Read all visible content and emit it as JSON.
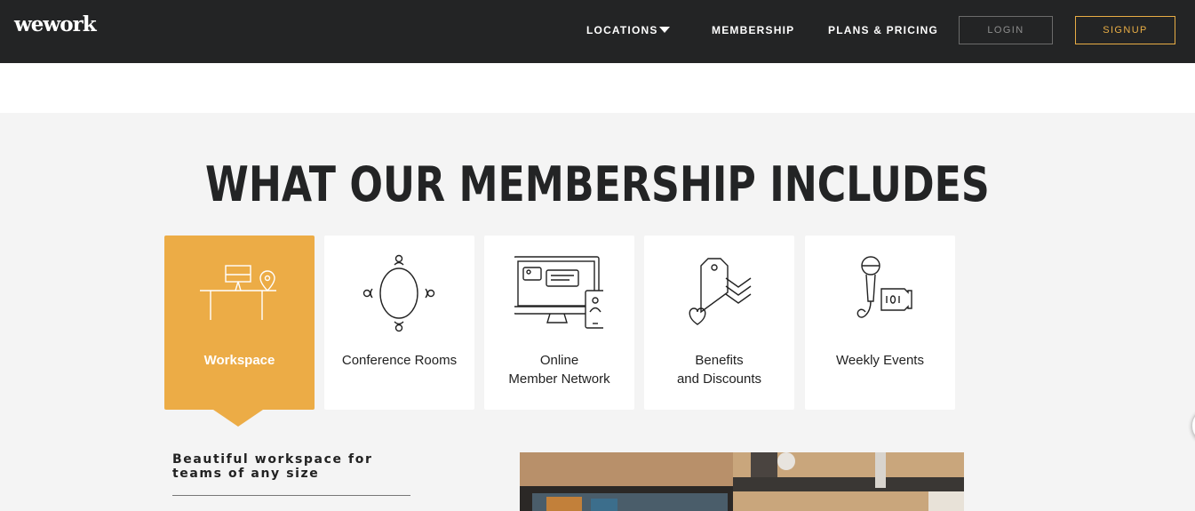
{
  "header": {
    "logo": "wework",
    "nav": {
      "locations": "LOCATIONS",
      "membership": "MEMBERSHIP",
      "pricing": "PLANS & PRICING"
    },
    "login": "LOGIN",
    "signup": "SIGNUP"
  },
  "section": {
    "title": "WHAT OUR MEMBERSHIP INCLUDES",
    "cards": [
      {
        "label": "Workspace",
        "icon": "workspace-desk-icon",
        "active": true
      },
      {
        "label": "Conference Rooms",
        "icon": "conference-table-icon",
        "active": false
      },
      {
        "label": "Online\nMember Network",
        "icon": "member-network-icon",
        "active": false
      },
      {
        "label": "Benefits\nand Discounts",
        "icon": "benefits-tag-icon",
        "active": false
      },
      {
        "label": "Weekly Events",
        "icon": "microphone-ticket-icon",
        "active": false
      }
    ],
    "description": "Beautiful workspace for teams of any size"
  },
  "colors": {
    "header_bg": "#232425",
    "accent": "#ecac46",
    "signup_border": "#e8ad45",
    "section_bg": "#f4f4f4"
  }
}
